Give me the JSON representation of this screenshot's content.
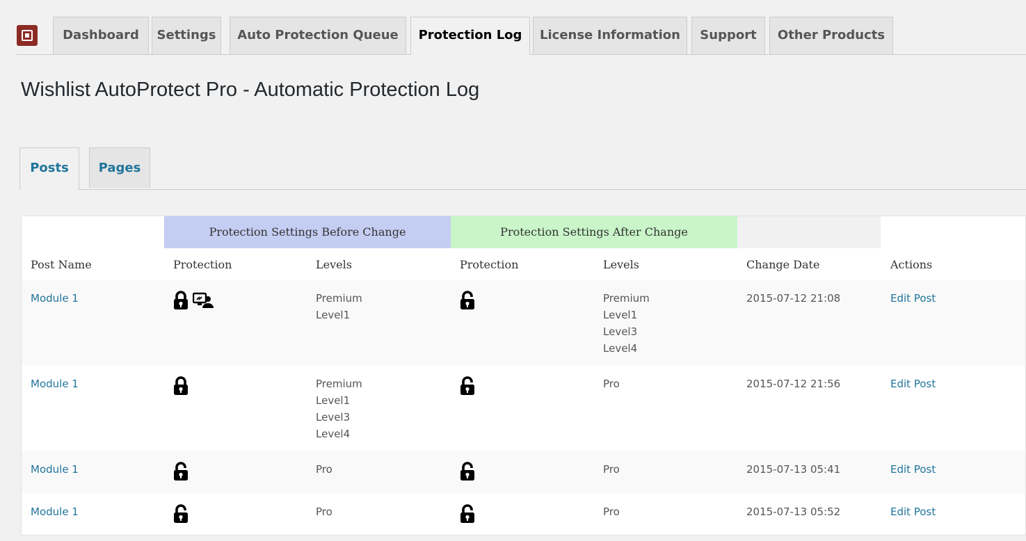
{
  "nav": {
    "tabs": [
      {
        "label": "Dashboard"
      },
      {
        "label": "Settings"
      },
      {
        "label": "Auto Protection Queue"
      },
      {
        "label": "Protection Log",
        "active": true
      },
      {
        "label": "License Information"
      },
      {
        "label": "Support"
      },
      {
        "label": "Other Products"
      }
    ]
  },
  "page": {
    "title": "Wishlist AutoProtect Pro - Automatic Protection Log"
  },
  "subtabs": [
    {
      "label": "Posts",
      "active": true
    },
    {
      "label": "Pages"
    }
  ],
  "table": {
    "group_headers": {
      "before": "Protection Settings Before Change",
      "after": "Protection Settings After Change"
    },
    "columns": {
      "post_name": "Post Name",
      "before_protection": "Protection",
      "before_levels": "Levels",
      "after_protection": "Protection",
      "after_levels": "Levels",
      "change_date": "Change Date",
      "actions": "Actions"
    },
    "rows": [
      {
        "post_name": "Module 1",
        "before_icons": [
          "lock-closed-icon",
          "user-access-icon"
        ],
        "before_levels": [
          "Premium",
          "Level1"
        ],
        "after_icons": [
          "lock-open-icon"
        ],
        "after_levels": [
          "Premium",
          "Level1",
          "Level3",
          "Level4"
        ],
        "change_date": "2015-07-12 21:08",
        "action": "Edit Post"
      },
      {
        "post_name": "Module 1",
        "before_icons": [
          "lock-closed-icon"
        ],
        "before_levels": [
          "Premium",
          "Level1",
          "Level3",
          "Level4"
        ],
        "after_icons": [
          "lock-open-icon"
        ],
        "after_levels": [
          "Pro"
        ],
        "change_date": "2015-07-12 21:56",
        "action": "Edit Post"
      },
      {
        "post_name": "Module 1",
        "before_icons": [
          "lock-open-icon"
        ],
        "before_levels": [
          "Pro"
        ],
        "after_icons": [
          "lock-open-icon"
        ],
        "after_levels": [
          "Pro"
        ],
        "change_date": "2015-07-13 05:41",
        "action": "Edit Post"
      },
      {
        "post_name": "Module 1",
        "before_icons": [
          "lock-open-icon"
        ],
        "before_levels": [
          "Pro"
        ],
        "after_icons": [
          "lock-open-icon"
        ],
        "after_levels": [
          "Pro"
        ],
        "change_date": "2015-07-13 05:52",
        "action": "Edit Post"
      }
    ]
  },
  "colors": {
    "link": "#21759b",
    "before_header_bg": "#c4cdf2",
    "after_header_bg": "#c9f5c9",
    "logo_bg": "#8c2a24"
  }
}
